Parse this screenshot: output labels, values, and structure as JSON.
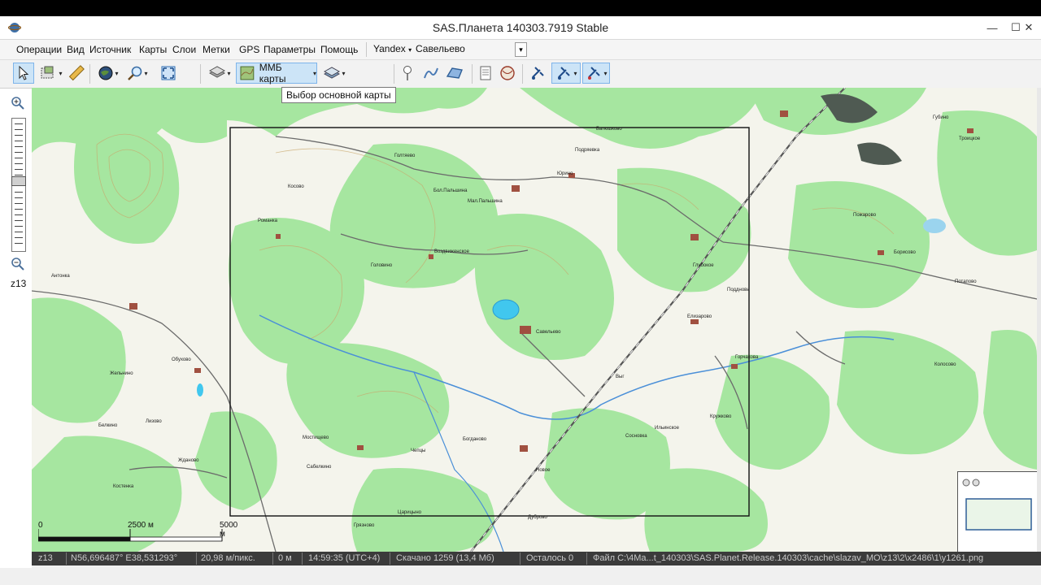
{
  "window": {
    "title": "SAS.Планета 140303.7919 Stable",
    "controls": {
      "minimize": "—",
      "maximize": "☐",
      "close": "✕"
    }
  },
  "menu": {
    "items": [
      "Операции",
      "Вид",
      "Источник",
      "Карты",
      "Слои",
      "Метки",
      "GPS",
      "Параметры",
      "Помощь"
    ],
    "search_engine": "Yandex",
    "search_value": "Савельево"
  },
  "toolbar": {
    "main_map_label": "ММБ карты",
    "tooltip": "Выбор основной карты"
  },
  "left_panel": {
    "zoom_label": "z13"
  },
  "map": {
    "scale_labels": [
      "0",
      "2500 м",
      "5000 м"
    ],
    "labels": {
      "savelievo": "Савельево",
      "golovino": "Головино",
      "vozdvizhenskoe": "Воздвиженское",
      "romanka": "Романка",
      "antonka": "Антонка",
      "obukhovo": "Обухово",
      "zhelnino": "Жельнино",
      "yurino": "Юрино",
      "podryaevo": "Подряевка",
      "batyushkino": "Батюшково",
      "mostishchevo": "Мостищево",
      "glubokoe": "Глубокое",
      "borisovo": "Борисово",
      "pozharovo": "Пожарово",
      "elizarovo": "Елизарово",
      "gorchakovo": "Горчакова",
      "ilyinskoe": "Ильинское",
      "kruzhkovo": "Кружково",
      "chepilovo": "Чепцы",
      "novoe": "Новое",
      "bogdanovo": "Богданово",
      "kolosovo": "Колосово",
      "potapovo": "Потапово",
      "gubino": "Губино",
      "vyg": "Выг",
      "sosnovka": "Сосновка",
      "dubrovo": "Дуброво",
      "belkino": "Белкино",
      "trostsy": "Троицкое",
      "podnov": "Поддновь",
      "bolshaya_palshina": "Бол.Пальшина",
      "malaya_palshina": "Мал.Пальшина",
      "goltyaevo": "Голтяево",
      "kosovo": "Косово",
      "kostenka": "Костенка",
      "zhdanovo": "Жданово",
      "lizovo": "Лизово",
      "sabelkino": "Сабелкино",
      "gryaznovo": "Грязново",
      "tsaritsyno": "Царицыно"
    }
  },
  "status": {
    "zoom": "z13",
    "coords": "N56,696487° E38,531293°",
    "resolution": "20,98 м/пикс.",
    "altitude": "0 м",
    "time": "14:59:35 (UTC+4)",
    "downloaded": "Скачано 1259 (13,4 Мб)",
    "remaining": "Осталось 0",
    "file": "Файл C:\\4Ma...t_140303\\SAS.Planet.Release.140303\\cache\\slazav_MO\\z13\\2\\x2486\\1\\y1261.png"
  }
}
